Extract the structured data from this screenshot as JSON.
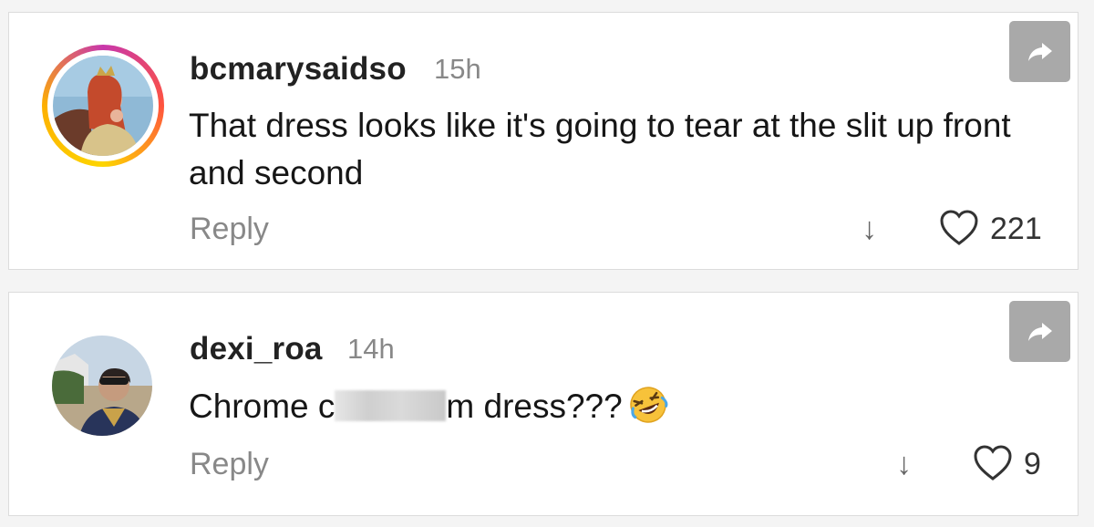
{
  "comments": [
    {
      "username": "bcmarysaidso",
      "time": "15h",
      "text": "That dress looks like it's going to tear at the slit up front and second",
      "reply_label": "Reply",
      "down_icon": "↓",
      "likes": "221",
      "has_story_ring": true
    },
    {
      "username": "dexi_roa",
      "time": "14h",
      "text_before": "Chrome c",
      "text_after": "m dress???",
      "emoji": "rolling-on-floor-laughing",
      "reply_label": "Reply",
      "down_icon": "↓",
      "likes": "9",
      "has_story_ring": false
    }
  ],
  "colors": {
    "ring_gradient": [
      "#c837ab",
      "#ff543e",
      "#fdd500"
    ],
    "share_button": "#a9a9a9",
    "muted_text": "#888888"
  }
}
